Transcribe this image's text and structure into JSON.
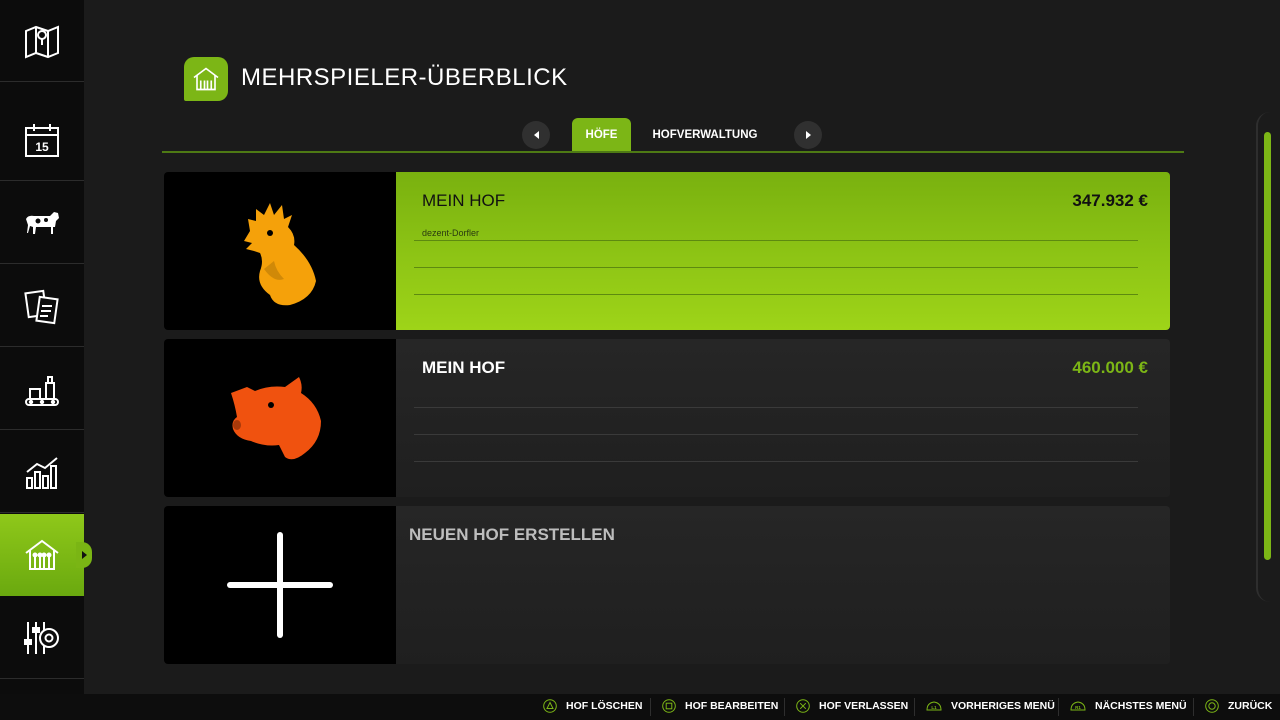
{
  "header": {
    "title": "MEHRSPIELER-ÜBERBLICK",
    "icon": "barn-icon"
  },
  "tabs": [
    {
      "label": "HÖFE",
      "active": true
    },
    {
      "label": "HOFVERWALTUNG",
      "active": false
    }
  ],
  "sidebar": {
    "items": [
      {
        "icon": "map-icon"
      },
      {
        "icon": "calendar-icon",
        "day": "15"
      },
      {
        "icon": "cow-icon"
      },
      {
        "icon": "contracts-icon"
      },
      {
        "icon": "production-icon"
      },
      {
        "icon": "statistics-icon"
      },
      {
        "icon": "barn-icon",
        "active": true
      },
      {
        "icon": "settings-icon"
      }
    ]
  },
  "farms": [
    {
      "name": "MEIN HOF",
      "money": "347.932 €",
      "players": [
        "dezent-Dorfler"
      ],
      "icon": "rooster-icon",
      "icon_color": "#f5a10a",
      "selected": true
    },
    {
      "name": "MEIN HOF",
      "money": "460.000 €",
      "players": [],
      "icon": "pig-icon",
      "icon_color": "#f0520f",
      "selected": false
    }
  ],
  "new_farm": {
    "label": "NEUEN HOF ERSTELLEN",
    "icon": "plus-icon"
  },
  "footer": {
    "hints": [
      {
        "glyph": "triangle-button-icon",
        "label": "HOF LÖSCHEN"
      },
      {
        "glyph": "square-button-icon",
        "label": "HOF BEARBEITEN"
      },
      {
        "glyph": "cross-button-icon",
        "label": "HOF VERLASSEN"
      },
      {
        "glyph": "l1-button-icon",
        "label": "VORHERIGES MENÜ"
      },
      {
        "glyph": "r1-button-icon",
        "label": "NÄCHSTES MENÜ"
      },
      {
        "glyph": "circle-button-icon",
        "label": "ZURÜCK"
      }
    ]
  },
  "colors": {
    "accent": "#7cb616",
    "background": "#1b1b1b",
    "sidebar": "#0c0c0c"
  }
}
